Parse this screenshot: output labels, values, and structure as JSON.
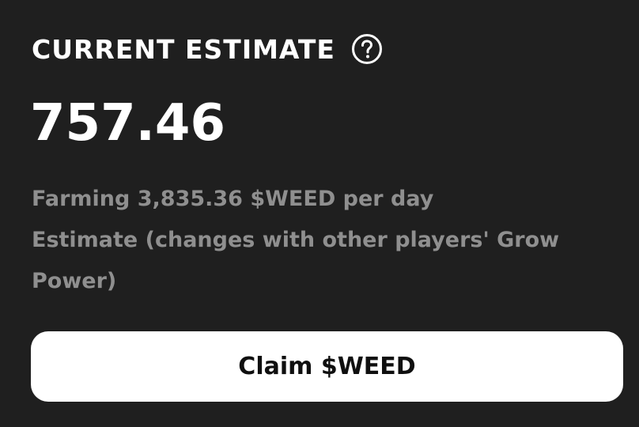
{
  "estimate": {
    "title": "CURRENT ESTIMATE",
    "help_icon": "question-circle-icon",
    "amount": "757.46",
    "farming_rate": "Farming 3,835.36 $WEED per day",
    "note_line1": "Estimate (changes with other players' Grow",
    "note_line2": "Power)"
  },
  "actions": {
    "claim_label": "Claim $WEED"
  },
  "colors": {
    "background": "#1f1f1f",
    "primary_text": "#ffffff",
    "secondary_text": "#8f8f8f",
    "button_background": "#ffffff",
    "button_text": "#0f0f0f"
  }
}
